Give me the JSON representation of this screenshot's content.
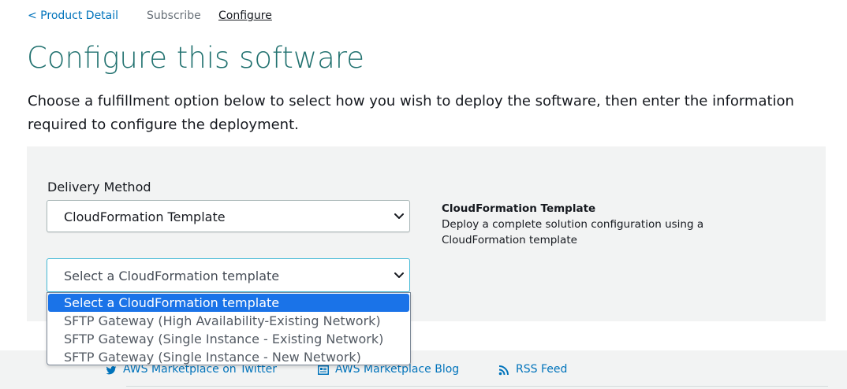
{
  "breadcrumb": {
    "back_label": "< Product Detail",
    "subscribe_label": "Subscribe",
    "configure_label": "Configure"
  },
  "page": {
    "title": "Configure this software",
    "intro": "Choose a fulfillment option below to select how you wish to deploy the software, then enter the information required to configure the deployment."
  },
  "delivery": {
    "label": "Delivery Method",
    "selected": "CloudFormation Template",
    "info_title": "CloudFormation Template",
    "info_desc": "Deploy a complete solution configuration using a CloudFormation template"
  },
  "template_select": {
    "selected": "Select a CloudFormation template",
    "options": [
      "Select a CloudFormation template",
      "SFTP Gateway (High Availability-Existing Network)",
      "SFTP Gateway (Single Instance - Existing Network)",
      "SFTP Gateway (Single Instance - New Network)"
    ],
    "highlighted_index": 0
  },
  "footer": {
    "twitter_label": "AWS Marketplace on Twitter",
    "blog_label": "AWS Marketplace Blog",
    "rss_label": "RSS Feed"
  },
  "icons": {
    "twitter": "twitter-icon",
    "blog": "newspaper-icon",
    "rss": "rss-icon",
    "chevron": "chevron-down-icon"
  },
  "colors": {
    "title": "#227270",
    "link": "#0073bb",
    "highlight": "#1a73e8",
    "panel": "#f2f3f3"
  }
}
